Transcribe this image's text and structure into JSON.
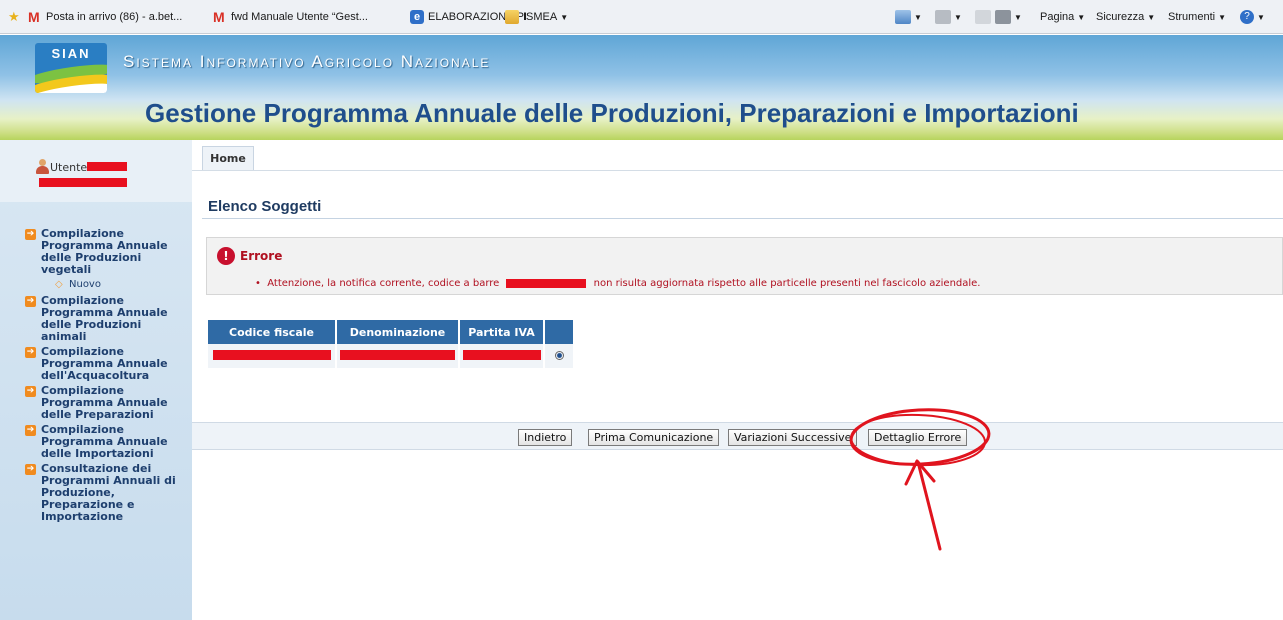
{
  "favorites": {
    "items": [
      {
        "label": "Posta in arrivo (86) - a.bet...",
        "icon": "gmail-icon"
      },
      {
        "label": "fwd Manuale Utente “Gest...",
        "icon": "gmail-icon"
      },
      {
        "label": "ELABORAZIONE PI",
        "icon": "ie-page-icon"
      },
      {
        "label": "ISMEA",
        "icon": "folder-icon"
      }
    ],
    "tools": {
      "page": "Pagina",
      "security": "Sicurezza",
      "tools": "Strumenti"
    }
  },
  "header": {
    "logo_text": "SIAN",
    "system_title": "Sistema Informativo Agricolo Nazionale",
    "app_title": "Gestione Programma Annuale delle Produzioni, Preparazioni e Importazioni"
  },
  "sidebar": {
    "user_label": "Utente:",
    "menu": [
      {
        "label": "Compilazione Programma Annuale delle Produzioni vegetali",
        "sub": "Nuovo"
      },
      {
        "label": "Compilazione Programma Annuale delle Produzioni animali"
      },
      {
        "label": "Compilazione Programma Annuale dell'Acquacoltura"
      },
      {
        "label": "Compilazione Programma Annuale delle Preparazioni"
      },
      {
        "label": "Compilazione Programma Annuale delle Importazioni"
      },
      {
        "label": "Consultazione dei Programmi Annuali di Produzione, Preparazione e Importazione"
      }
    ]
  },
  "main": {
    "home_tab": "Home",
    "page_title": "Elenco Soggetti",
    "error": {
      "title": "Errore",
      "message_before": "Attenzione, la notifica corrente, codice a barre",
      "message_after": "non risulta aggiornata rispetto alle particelle presenti nel fascicolo aziendale."
    },
    "table": {
      "headers": [
        "Codice fiscale",
        "Denominazione",
        "Partita IVA",
        ""
      ]
    },
    "buttons": {
      "back": "Indietro",
      "first": "Prima Comunicazione",
      "variations": "Variazioni Successive",
      "error_detail": "Dettaglio Errore"
    }
  },
  "colors": {
    "redaction": "#e8101f",
    "table_header": "#2f6aa5",
    "error_text": "#b01020",
    "annotation": "#e0141e"
  }
}
